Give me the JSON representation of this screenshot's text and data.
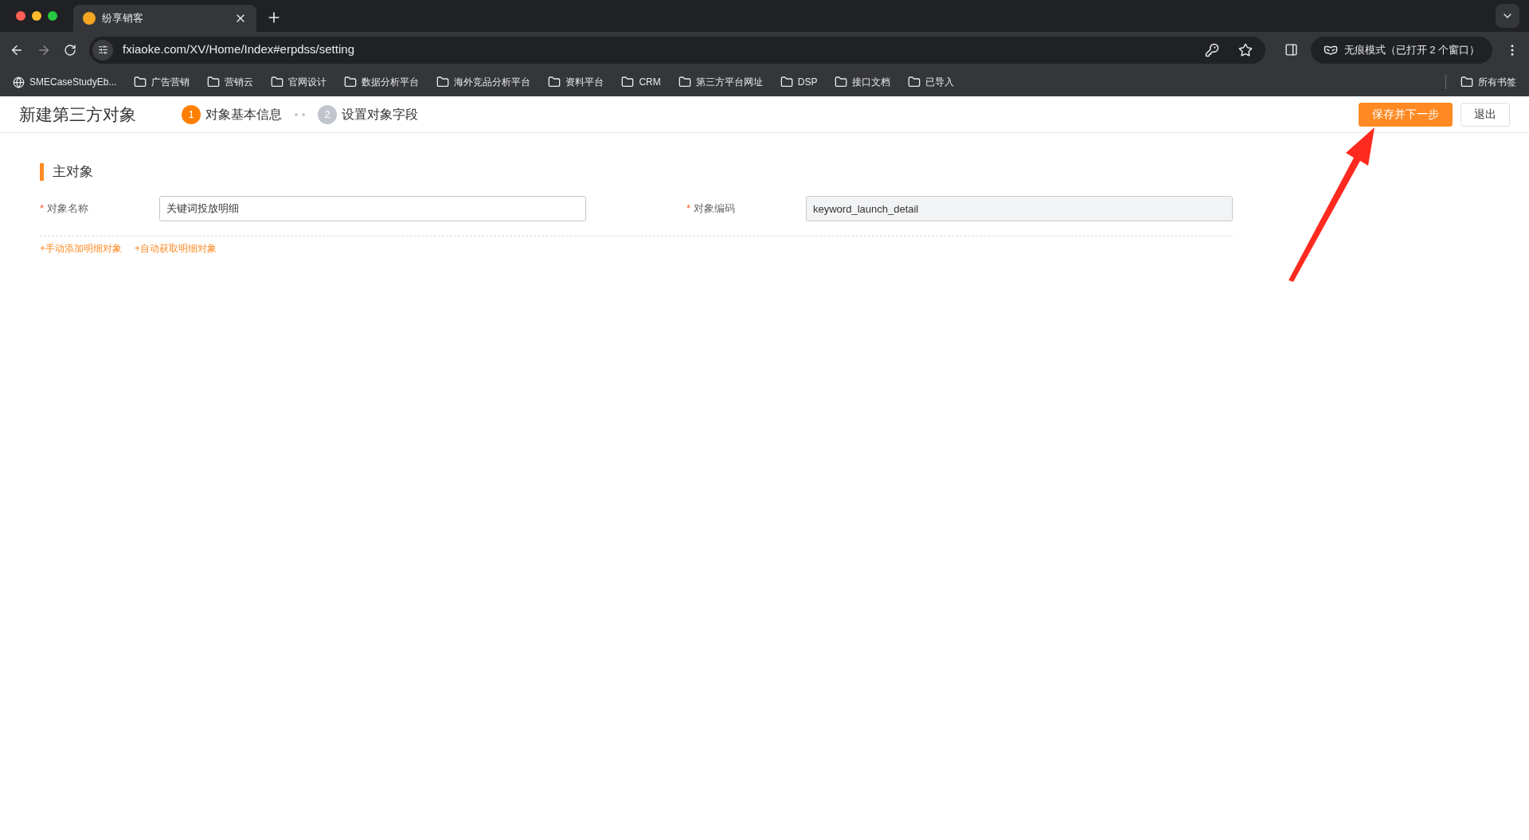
{
  "browser": {
    "tabs": [
      {
        "title": "纷享销客",
        "selected": true
      }
    ],
    "url": "fxiaoke.com/XV/Home/Index#erpdss/setting",
    "profile": "无痕模式（已打开 2 个窗口）",
    "bookmarks": [
      {
        "label": "SMECaseStudyEb...",
        "kind": "site"
      },
      {
        "label": "广告营销",
        "kind": "folder"
      },
      {
        "label": "营销云",
        "kind": "folder"
      },
      {
        "label": "官网设计",
        "kind": "folder"
      },
      {
        "label": "数据分析平台",
        "kind": "folder"
      },
      {
        "label": "海外竞品分析平台",
        "kind": "folder"
      },
      {
        "label": "资料平台",
        "kind": "folder"
      },
      {
        "label": "CRM",
        "kind": "folder"
      },
      {
        "label": "第三方平台网址",
        "kind": "folder"
      },
      {
        "label": "DSP",
        "kind": "folder"
      },
      {
        "label": "接口文档",
        "kind": "folder"
      },
      {
        "label": "已导入",
        "kind": "folder"
      }
    ],
    "all_bookmarks": "所有书签"
  },
  "page": {
    "title": "新建第三方对象",
    "steps": [
      {
        "number": "1",
        "label": "对象基本信息",
        "selected": true
      },
      {
        "number": "2",
        "label": "设置对象字段",
        "selected": false
      }
    ],
    "buttons": [
      {
        "label": "保存并下一步",
        "kind": "primary"
      },
      {
        "label": "退出",
        "kind": "default"
      }
    ],
    "section_title": "主对象",
    "fields": [
      {
        "required_mark": "*",
        "label": "对象名称",
        "value": "关键词投放明细",
        "disabled": false
      },
      {
        "required_mark": "*",
        "label": "对象编码",
        "value": "keyword_launch_detail",
        "disabled": true
      }
    ],
    "links": [
      "+手动添加明细对象",
      "+自动获取明细对象"
    ]
  }
}
